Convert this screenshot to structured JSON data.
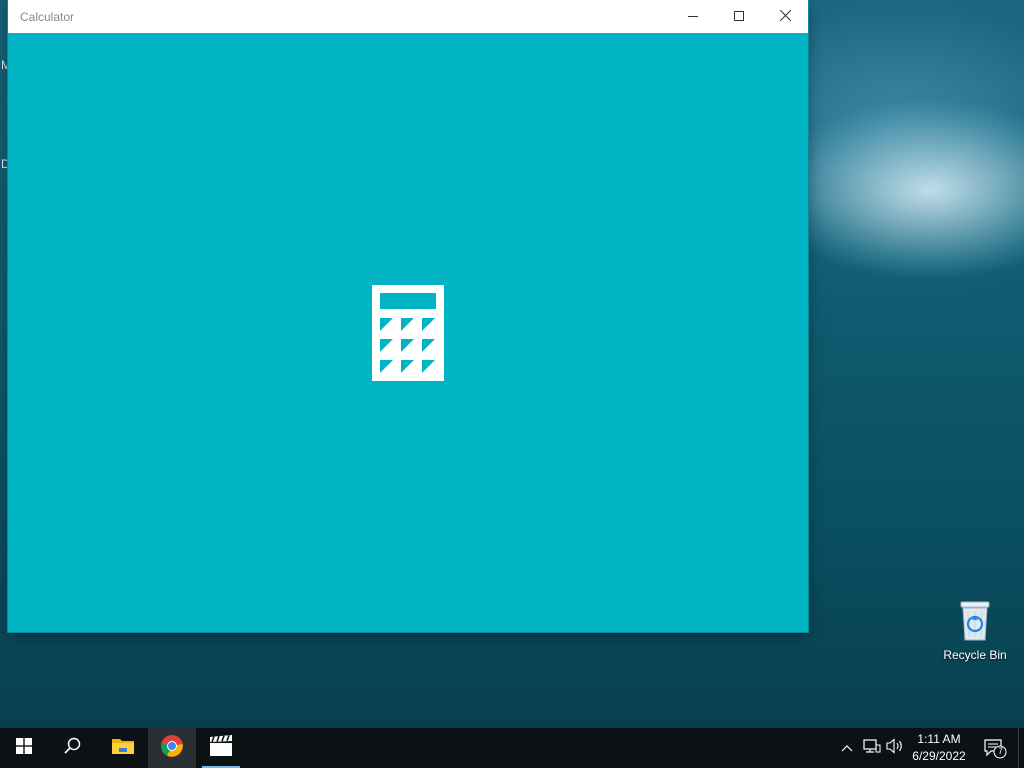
{
  "window": {
    "title": "Calculator",
    "splash_icon": "calculator-icon",
    "background_color": "#00b4c4"
  },
  "desktop": {
    "edge_chars": [
      "M",
      "D"
    ],
    "icons": [
      {
        "label": "Recycle Bin",
        "icon": "recycle-bin-icon"
      }
    ]
  },
  "taskbar": {
    "items": [
      {
        "name": "start",
        "icon": "windows-start-icon"
      },
      {
        "name": "search",
        "icon": "search-icon"
      },
      {
        "name": "file-explorer",
        "icon": "folder-icon"
      },
      {
        "name": "chrome",
        "icon": "chrome-icon"
      },
      {
        "name": "movies-tv",
        "icon": "clapperboard-icon"
      }
    ],
    "tray": {
      "time": "1:11 AM",
      "date": "6/29/2022",
      "notification_count": "7"
    }
  }
}
